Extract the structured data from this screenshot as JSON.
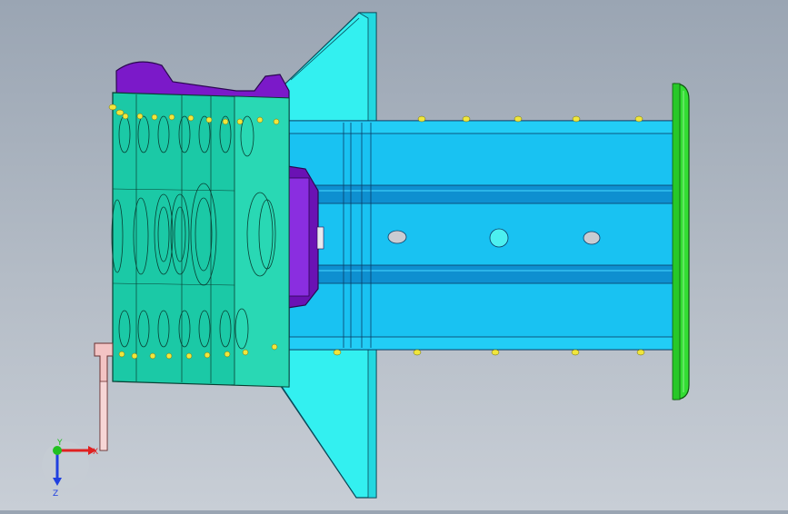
{
  "viewport": {
    "background_top": "#9aa5b3",
    "background_bottom": "#c8ced6"
  },
  "colors": {
    "flange_cyan": "#33f0f0",
    "tube_blue": "#19c2f2",
    "tube_dark": "#0e8fd0",
    "bracket_teal": "#1bc9a6",
    "mount_purple": "#7b19c9",
    "endplate_green": "#33dd33",
    "weld_yellow": "#f0e63c",
    "rod_pink": "#f3c4c4"
  },
  "parts": [
    {
      "name": "flange-plate",
      "color": "flange_cyan"
    },
    {
      "name": "box-tube",
      "color": "tube_blue"
    },
    {
      "name": "mounting-bracket",
      "color": "bracket_teal"
    },
    {
      "name": "mount-insert",
      "color": "mount_purple"
    },
    {
      "name": "end-plate",
      "color": "endplate_green"
    },
    {
      "name": "support-rod",
      "color": "rod_pink"
    }
  ],
  "triad": {
    "x_label": "X",
    "y_label": "Y",
    "z_label": "Z",
    "x_color": "#e02020",
    "y_color": "#20c020",
    "z_color": "#2040e0"
  }
}
